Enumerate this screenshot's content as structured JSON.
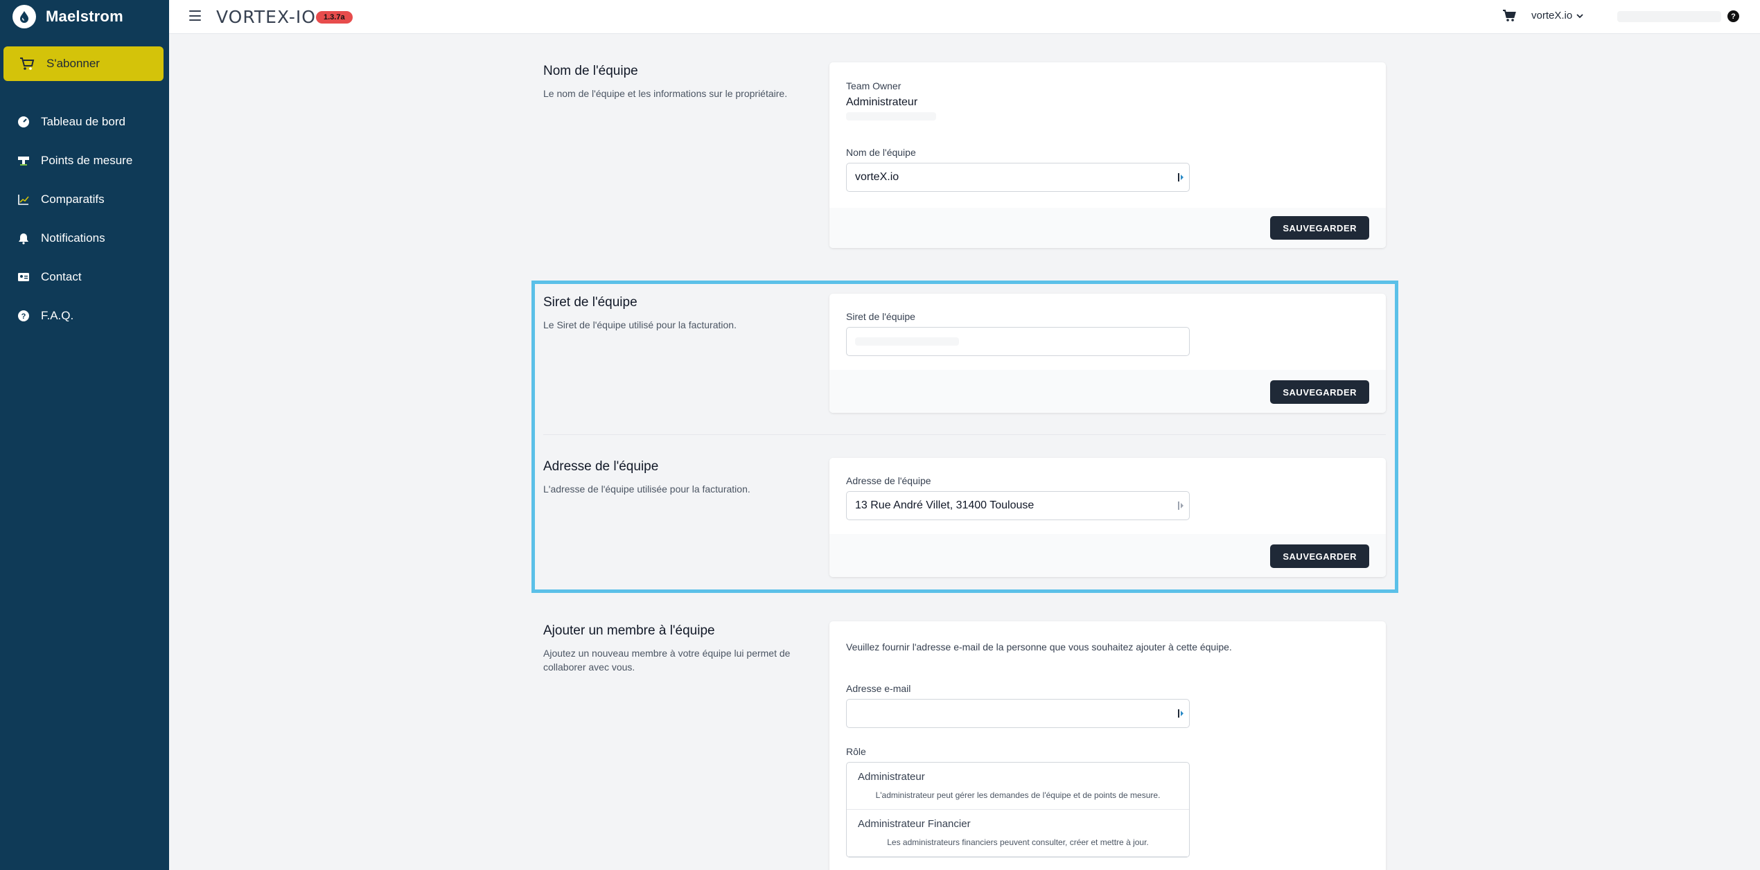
{
  "app": {
    "brand": "Maelstrom",
    "logo_text": "VORTEX-IO",
    "version": "1.3.7a",
    "team_name": "vorteX.io"
  },
  "sidebar": {
    "subscribe_label": "S'abonner",
    "items": [
      {
        "label": "Tableau de bord",
        "icon": "dashboard-icon"
      },
      {
        "label": "Points de mesure",
        "icon": "station-icon"
      },
      {
        "label": "Comparatifs",
        "icon": "chart-icon"
      },
      {
        "label": "Notifications",
        "icon": "bell-icon"
      },
      {
        "label": "Contact",
        "icon": "contact-card-icon"
      },
      {
        "label": "F.A.Q.",
        "icon": "question-icon"
      }
    ]
  },
  "team_name_section": {
    "title": "Nom de l'équipe",
    "description": "Le nom de l'équipe et les informations sur le propriétaire.",
    "owner_label": "Team Owner",
    "owner_name": "Administrateur",
    "field_label": "Nom de l'équipe",
    "field_value": "vorteX.io",
    "save_label": "SAUVEGARDER"
  },
  "siret_section": {
    "title": "Siret de l'équipe",
    "description": "Le Siret de l'équipe utilisé pour la facturation.",
    "field_label": "Siret de l'équipe",
    "field_value": "",
    "save_label": "SAUVEGARDER"
  },
  "address_section": {
    "title": "Adresse de l'équipe",
    "description": "L'adresse de l'équipe utilisée pour la facturation.",
    "field_label": "Adresse de l'équipe",
    "field_value": "13 Rue André Villet, 31400 Toulouse",
    "save_label": "SAUVEGARDER"
  },
  "add_member_section": {
    "title": "Ajouter un membre à l'équipe",
    "description": "Ajoutez un nouveau membre à votre équipe lui permet de collaborer avec vous.",
    "intro": "Veuillez fournir l'adresse e-mail de la personne que vous souhaitez ajouter à cette équipe.",
    "email_label": "Adresse e-mail",
    "email_value": "",
    "role_label": "Rôle",
    "roles": [
      {
        "name": "Administrateur",
        "description": "L'administrateur peut gérer les demandes de l'équipe et de points de mesure."
      },
      {
        "name": "Administrateur Financier",
        "description": "Les administrateurs financiers peuvent consulter, créer et mettre à jour."
      }
    ]
  },
  "colors": {
    "sidebar_bg": "#0f3a57",
    "accent": "#d4c30a",
    "version_badge": "#e74c4c",
    "highlight_border": "#5bc0e8",
    "button_bg": "#1f2937"
  }
}
